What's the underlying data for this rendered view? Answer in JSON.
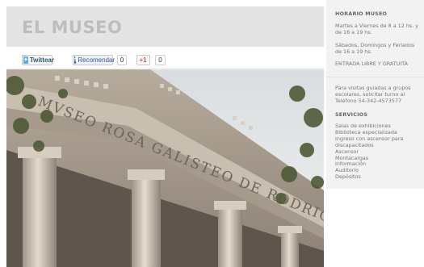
{
  "page": {
    "title": "EL MUSEO"
  },
  "share": {
    "twitter_label": "Twittear",
    "facebook_label": "Recomendar",
    "facebook_count": "0",
    "gplus_label": "+1",
    "gplus_count": "0"
  },
  "photo": {
    "inscription": "MVSEO ROSA GALISTEO DE RODRIGUEZ"
  },
  "sidebar": {
    "horario_title": "HORARIO MUSEO",
    "horario_weekday": "Martes a Viernes de 8 a 12 hs. y de 16 a 19 hs.",
    "horario_weekend": "Sábados, Domingos y Feriados de 16 a 19 hs.",
    "entrada": "ENTRADA LIBRE Y GRATUITA",
    "visitas": "Para visitas guiadas a grupos escolares, solicitar turno al Teléfono 54-342-4573577",
    "servicios_title": "SERVICIOS",
    "servicios": [
      "Salas de exhibiciones",
      "Biblioteca especializada",
      "Ingreso con ascensor para discapacitados",
      "Ascensor",
      "Montacargas",
      "Información",
      "Auditorio",
      "Depósitos"
    ]
  },
  "colors": {
    "title": "#bdbdbd",
    "title_bar": "#e4e4e4",
    "sidebar_bg": "#f2f2f2",
    "twitter": "#55acee",
    "facebook": "#3b5998",
    "gplus": "#dd4b39"
  }
}
